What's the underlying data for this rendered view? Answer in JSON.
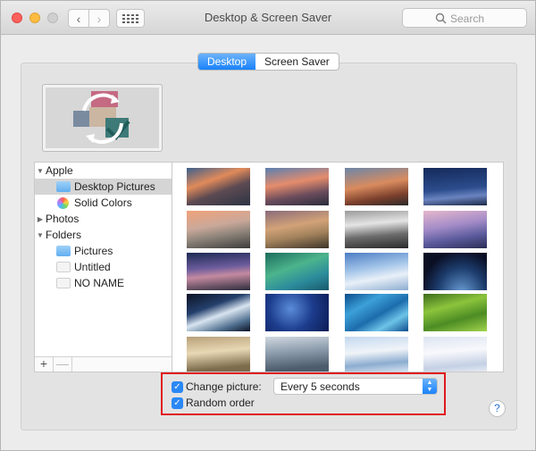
{
  "window": {
    "title": "Desktop & Screen Saver"
  },
  "toolbar": {
    "back_icon": "chevron-left",
    "forward_icon": "chevron-right",
    "grid_icon": "show-all-grid"
  },
  "search": {
    "placeholder": "Search"
  },
  "tabs": [
    {
      "label": "Desktop",
      "selected": true
    },
    {
      "label": "Screen Saver",
      "selected": false
    }
  ],
  "sidebar": {
    "items": [
      {
        "label": "Apple",
        "type": "group",
        "expanded": true
      },
      {
        "label": "Desktop Pictures",
        "type": "folder",
        "selected": true
      },
      {
        "label": "Solid Colors",
        "type": "colors"
      },
      {
        "label": "Photos",
        "type": "group",
        "expanded": false
      },
      {
        "label": "Folders",
        "type": "group",
        "expanded": true
      },
      {
        "label": "Pictures",
        "type": "folder"
      },
      {
        "label": "Untitled",
        "type": "blank"
      },
      {
        "label": "NO NAME",
        "type": "blank"
      }
    ],
    "add_label": "+",
    "remove_label": "—"
  },
  "thumbnails": [
    "sierra-mountains-sunset",
    "sierra-ridge-dusk",
    "el-capitan-glow",
    "el-capitan-night",
    "yosemite-sunset",
    "yosemite-half-dome",
    "yosemite-clouds",
    "mountain-purple-dusk",
    "lake-night",
    "green-waves",
    "snow-dune",
    "earth-horizon",
    "earth-from-space",
    "blue-particles",
    "blue-ripples",
    "green-terraces",
    "foggy-forest",
    "mountain-haze",
    "snow-river",
    "snow-drifts"
  ],
  "options": {
    "change_picture_label": "Change picture:",
    "change_picture_checked": true,
    "interval_value": "Every 5 seconds",
    "random_order_label": "Random order",
    "random_order_checked": true
  },
  "help_label": "?"
}
